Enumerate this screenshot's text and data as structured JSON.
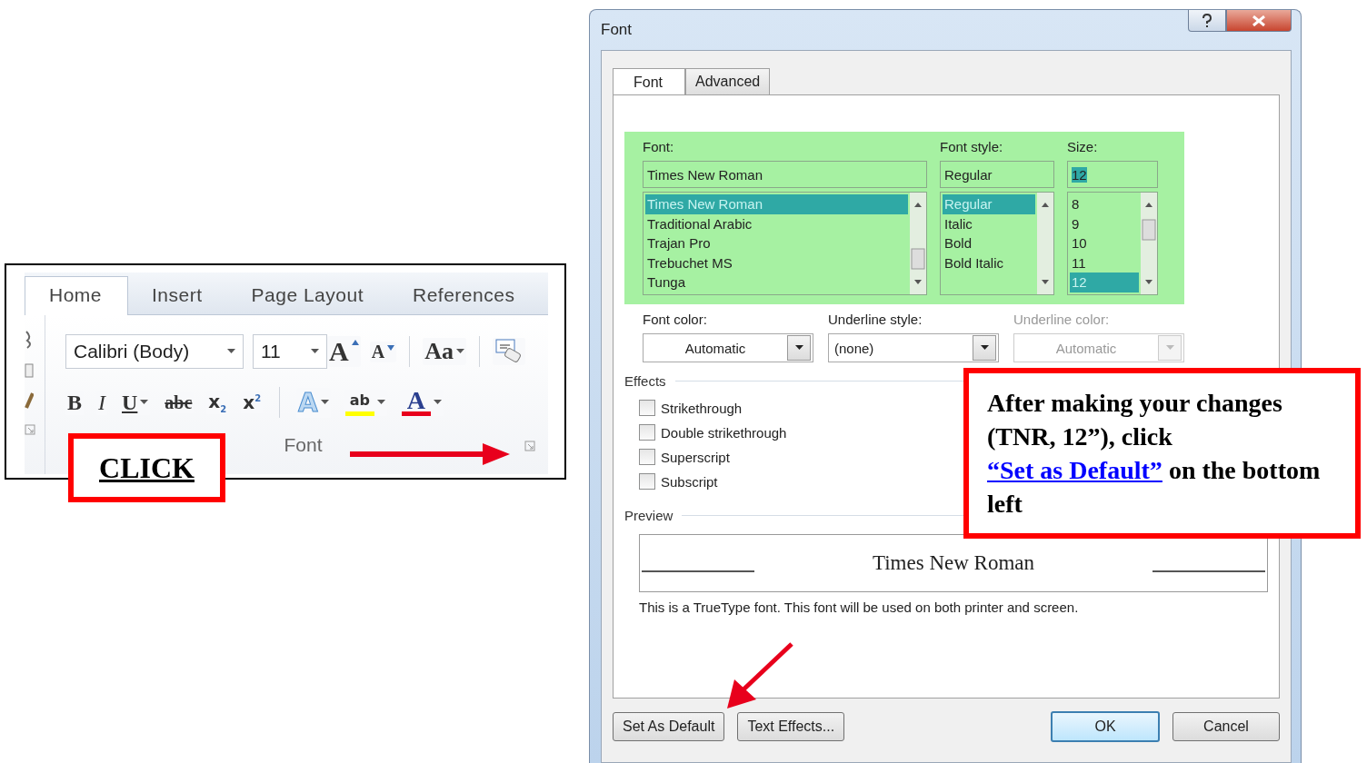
{
  "ribbon": {
    "tabs": [
      {
        "label": "Home",
        "selected": true
      },
      {
        "label": "Insert",
        "selected": false
      },
      {
        "label": "Page Layout",
        "selected": false
      },
      {
        "label": "References",
        "selected": false
      }
    ],
    "font_name": "Calibri (Body)",
    "font_size": "11",
    "row_1": [
      {
        "kind": "grow",
        "label": "A",
        "dropdown": false
      },
      {
        "kind": "shrink",
        "label": "A",
        "dropdown": false
      },
      {
        "kind": "case",
        "label": "Aa",
        "dropdown": true
      },
      {
        "kind": "clear",
        "dropdown": false
      }
    ],
    "row_2": [
      {
        "kind": "bold",
        "label": "B",
        "dropdown": false
      },
      {
        "kind": "italic",
        "label": "I",
        "dropdown": false
      },
      {
        "kind": "underline",
        "label": "U",
        "dropdown": true
      },
      {
        "kind": "strike",
        "label": "abc",
        "dropdown": false
      },
      {
        "kind": "script",
        "label": "x$_{2}$",
        "dropdown": false
      },
      {
        "kind": "script",
        "label": "x$^{2}$",
        "dropdown": false
      },
      {
        "kind": "effects",
        "label": "A",
        "dropdown": true
      },
      {
        "kind": "colorbar",
        "label": "ab",
        "dropdown": true,
        "color": "#ffff00"
      },
      {
        "kind": "colorbar",
        "label": "A",
        "dropdown": true,
        "color": "#e8001c"
      }
    ],
    "group_label": "Font"
  },
  "click_callout": {
    "text": "CLICK"
  },
  "dialog": {
    "title": "Font",
    "tabs": [
      {
        "label": "Font",
        "selected": true
      },
      {
        "label": "Advanced",
        "selected": false
      }
    ],
    "lists": [
      {
        "label": "Font:",
        "value": "Times New Roman",
        "items": [
          {
            "label": "Times New Roman",
            "selected": true
          },
          {
            "label": "Traditional Arabic",
            "selected": false
          },
          {
            "label": "Trajan Pro",
            "selected": false
          },
          {
            "label": "Trebuchet MS",
            "selected": false
          },
          {
            "label": "Tunga",
            "selected": false
          }
        ]
      },
      {
        "label": "Font style:",
        "value": "Regular",
        "items": [
          {
            "label": "Regular",
            "selected": true
          },
          {
            "label": "Italic",
            "selected": false
          },
          {
            "label": "Bold",
            "selected": false
          },
          {
            "label": "Bold Italic",
            "selected": false
          }
        ]
      },
      {
        "label": "Size:",
        "value": "12",
        "items": [
          {
            "label": "8",
            "selected": false
          },
          {
            "label": "9",
            "selected": false
          },
          {
            "label": "10",
            "selected": false
          },
          {
            "label": "11",
            "selected": false
          },
          {
            "label": "12",
            "selected": true
          }
        ]
      }
    ],
    "combos": [
      {
        "label": "Font color:",
        "value": "Automatic",
        "disabled": false
      },
      {
        "label": "Underline style:",
        "value": "(none)",
        "disabled": false
      },
      {
        "label": "Underline color:",
        "value": "Automatic",
        "disabled": true
      }
    ],
    "effects": {
      "title": "Effects",
      "items": [
        {
          "label": "Strikethrough",
          "checked": false
        },
        {
          "label": "Double strikethrough",
          "checked": false
        },
        {
          "label": "Superscript",
          "checked": false
        },
        {
          "label": "Subscript",
          "checked": false
        }
      ]
    },
    "preview": {
      "title": "Preview",
      "sample": "Times New Roman",
      "note": "This is a TrueType font. This font will be used on both printer and screen."
    },
    "buttons": [
      {
        "label": "Set As Default",
        "focused": false
      },
      {
        "label": "Text Effects...",
        "focused": false
      },
      {
        "label": "OK",
        "focused": true
      },
      {
        "label": "Cancel",
        "focused": false
      }
    ]
  },
  "instruction_callout": {
    "before": "After making your changes (TNR, 12”), click",
    "link": "“Set as Default”",
    "after": "on the bottom left"
  }
}
